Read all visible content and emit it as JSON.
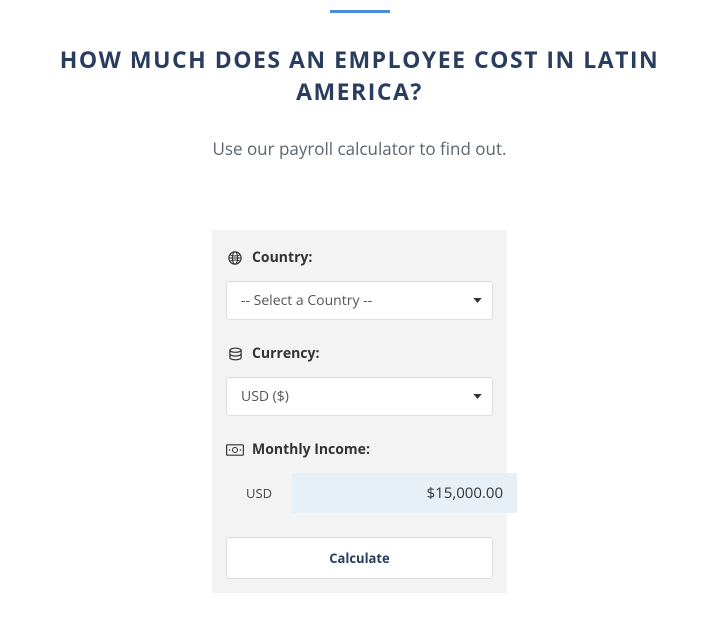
{
  "header": {
    "title": "HOW MUCH DOES AN EMPLOYEE COST IN LATIN AMERICA?",
    "subtitle": "Use our payroll calculator to find out."
  },
  "form": {
    "country": {
      "label": "Country:",
      "placeholder": "-- Select a Country --"
    },
    "currency": {
      "label": "Currency:",
      "selected": "USD ($)"
    },
    "income": {
      "label": "Monthly Income:",
      "prefix": "USD",
      "value": "$15,000.00"
    },
    "submit_label": "Calculate"
  }
}
